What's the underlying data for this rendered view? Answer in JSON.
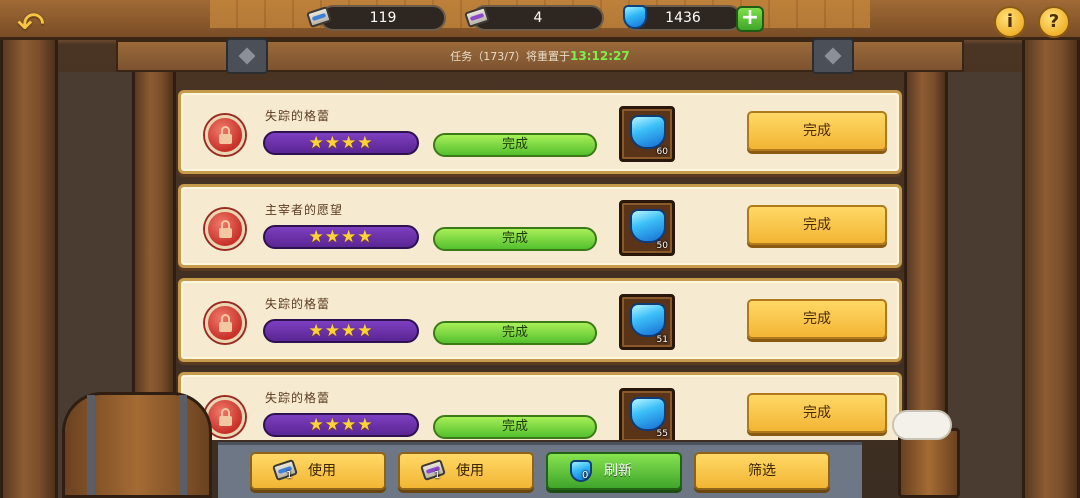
{
  "resources": [
    {
      "name": "scroll-blue",
      "value": "119"
    },
    {
      "name": "scroll-purple",
      "value": "4"
    },
    {
      "name": "gems",
      "value": "1436"
    }
  ],
  "top_buttons": {
    "plus": "+",
    "info": "i",
    "help": "?"
  },
  "task_info": {
    "text": "任务（173/7）将重置于",
    "timer": "13:12:27"
  },
  "quests": [
    {
      "name": "失踪的格蕾",
      "stars": "★★★★",
      "progress": "完成",
      "reward_qty": "60",
      "button": "完成"
    },
    {
      "name": "主宰者的愿望",
      "stars": "★★★★",
      "progress": "完成",
      "reward_qty": "50",
      "button": "完成"
    },
    {
      "name": "失踪的格蕾",
      "stars": "★★★★",
      "progress": "完成",
      "reward_qty": "51",
      "button": "完成"
    },
    {
      "name": "失踪的格蕾",
      "stars": "★★★★",
      "progress": "完成",
      "reward_qty": "55",
      "button": "完成"
    }
  ],
  "bottom_buttons": {
    "use1": {
      "label": "使用",
      "count": "1"
    },
    "use2": {
      "label": "使用",
      "count": "1"
    },
    "refresh": {
      "label": "刷新",
      "count": "0"
    },
    "filter": {
      "label": "筛选"
    }
  },
  "colors": {
    "accent_yellow": "#f2b534",
    "accent_green": "#54c02e",
    "star_purple": "#5a2594",
    "timer_green": "#7cf04a"
  }
}
